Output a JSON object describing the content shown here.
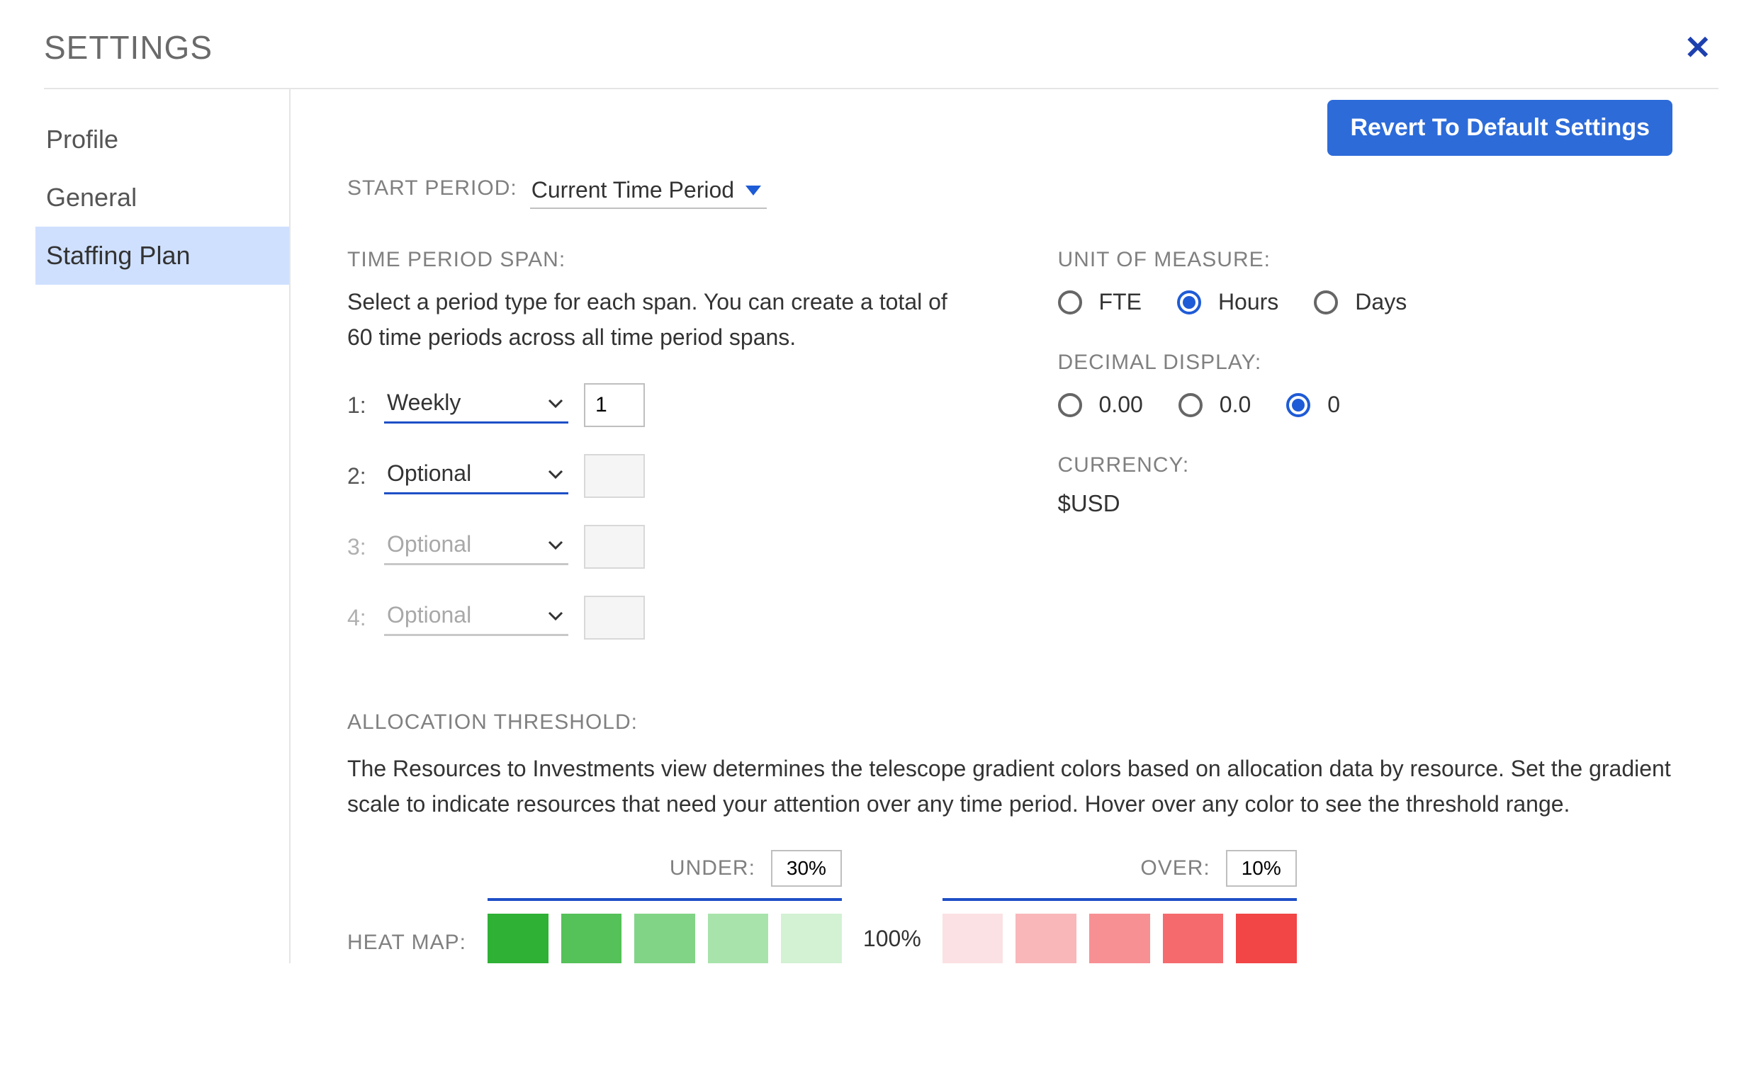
{
  "page_title": "SETTINGS",
  "close_glyph": "✕",
  "sidebar": {
    "items": [
      {
        "label": "Profile",
        "active": false
      },
      {
        "label": "General",
        "active": false
      },
      {
        "label": "Staffing Plan",
        "active": true
      }
    ]
  },
  "revert_button_label": "Revert To Default Settings",
  "start_period": {
    "label": "START PERIOD:",
    "value": "Current Time Period"
  },
  "time_period_span": {
    "label": "TIME PERIOD SPAN:",
    "help": "Select a period type for each span. You can create a total of 60 time periods across all time period spans.",
    "rows": [
      {
        "idx": "1:",
        "value": "Weekly",
        "count": "1",
        "enabled": true
      },
      {
        "idx": "2:",
        "value": "Optional",
        "count": "",
        "enabled": true
      },
      {
        "idx": "3:",
        "value": "Optional",
        "count": "",
        "enabled": false
      },
      {
        "idx": "4:",
        "value": "Optional",
        "count": "",
        "enabled": false
      }
    ]
  },
  "unit_of_measure": {
    "label": "UNIT OF MEASURE:",
    "options": [
      {
        "label": "FTE",
        "selected": false
      },
      {
        "label": "Hours",
        "selected": true
      },
      {
        "label": "Days",
        "selected": false
      }
    ]
  },
  "decimal_display": {
    "label": "DECIMAL DISPLAY:",
    "options": [
      {
        "label": "0.00",
        "selected": false
      },
      {
        "label": "0.0",
        "selected": false
      },
      {
        "label": "0",
        "selected": true
      }
    ]
  },
  "currency": {
    "label": "CURRENCY:",
    "value": "$USD"
  },
  "allocation": {
    "label": "ALLOCATION THRESHOLD:",
    "help": "The Resources to Investments view determines the telescope gradient colors based on allocation data by resource. Set the gradient scale to indicate resources that need your attention over any time period. Hover over any color to see the threshold range.",
    "heat_label": "HEAT MAP:",
    "under_label": "UNDER:",
    "under_value": "30%",
    "center_value": "100%",
    "over_label": "OVER:",
    "over_value": "10%",
    "under_colors": [
      "#2eb135",
      "#54c159",
      "#81d486",
      "#a8e3ab",
      "#d2f2d3"
    ],
    "over_colors": [
      "#fbe1e3",
      "#f9b7ba",
      "#f79093",
      "#f56a6d",
      "#f24545"
    ]
  }
}
